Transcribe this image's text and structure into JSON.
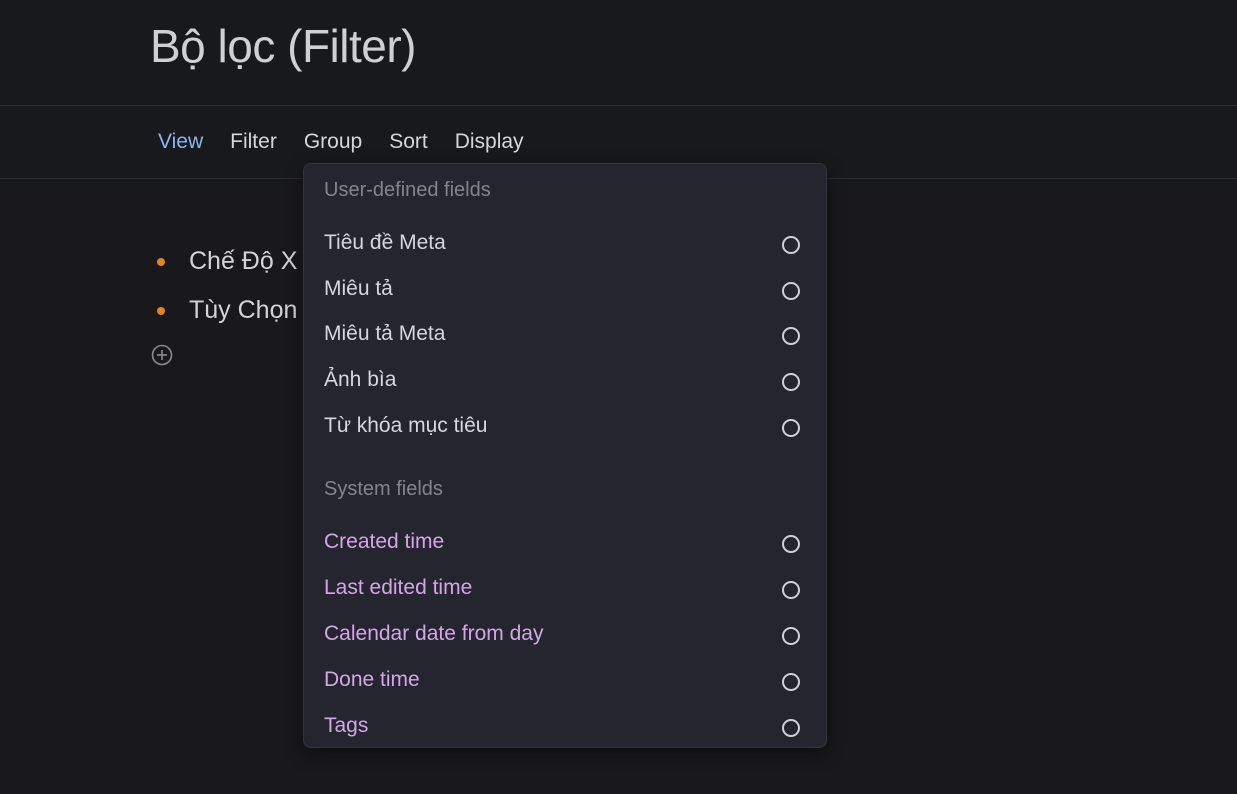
{
  "header": {
    "title": "Bộ lọc (Filter)"
  },
  "toolbar": {
    "tabs": [
      {
        "label": "View",
        "active": true
      },
      {
        "label": "Filter",
        "active": false
      },
      {
        "label": "Group",
        "active": false
      },
      {
        "label": "Sort",
        "active": false
      },
      {
        "label": "Display",
        "active": false
      }
    ]
  },
  "content": {
    "items": [
      {
        "label": "Chế Độ X"
      },
      {
        "label": "Tùy Chọn"
      }
    ],
    "add_icon": "plus-circle-icon"
  },
  "dropdown": {
    "user_section_label": "User-defined fields",
    "user_fields": [
      {
        "label": "Tiêu đề Meta",
        "selected": false
      },
      {
        "label": "Miêu tả",
        "selected": false
      },
      {
        "label": "Miêu tả Meta",
        "selected": false
      },
      {
        "label": "Ảnh bìa",
        "selected": false
      },
      {
        "label": "Từ khóa mục tiêu",
        "selected": false
      }
    ],
    "system_section_label": "System fields",
    "system_fields": [
      {
        "label": "Created time",
        "selected": false
      },
      {
        "label": "Last edited time",
        "selected": false
      },
      {
        "label": "Calendar date from day",
        "selected": false
      },
      {
        "label": "Done time",
        "selected": false
      },
      {
        "label": "Tags",
        "selected": false
      }
    ]
  },
  "colors": {
    "accent_tab": "#8fb4ec",
    "bullet": "#e8821e",
    "system_field": "#d4a6e6"
  }
}
